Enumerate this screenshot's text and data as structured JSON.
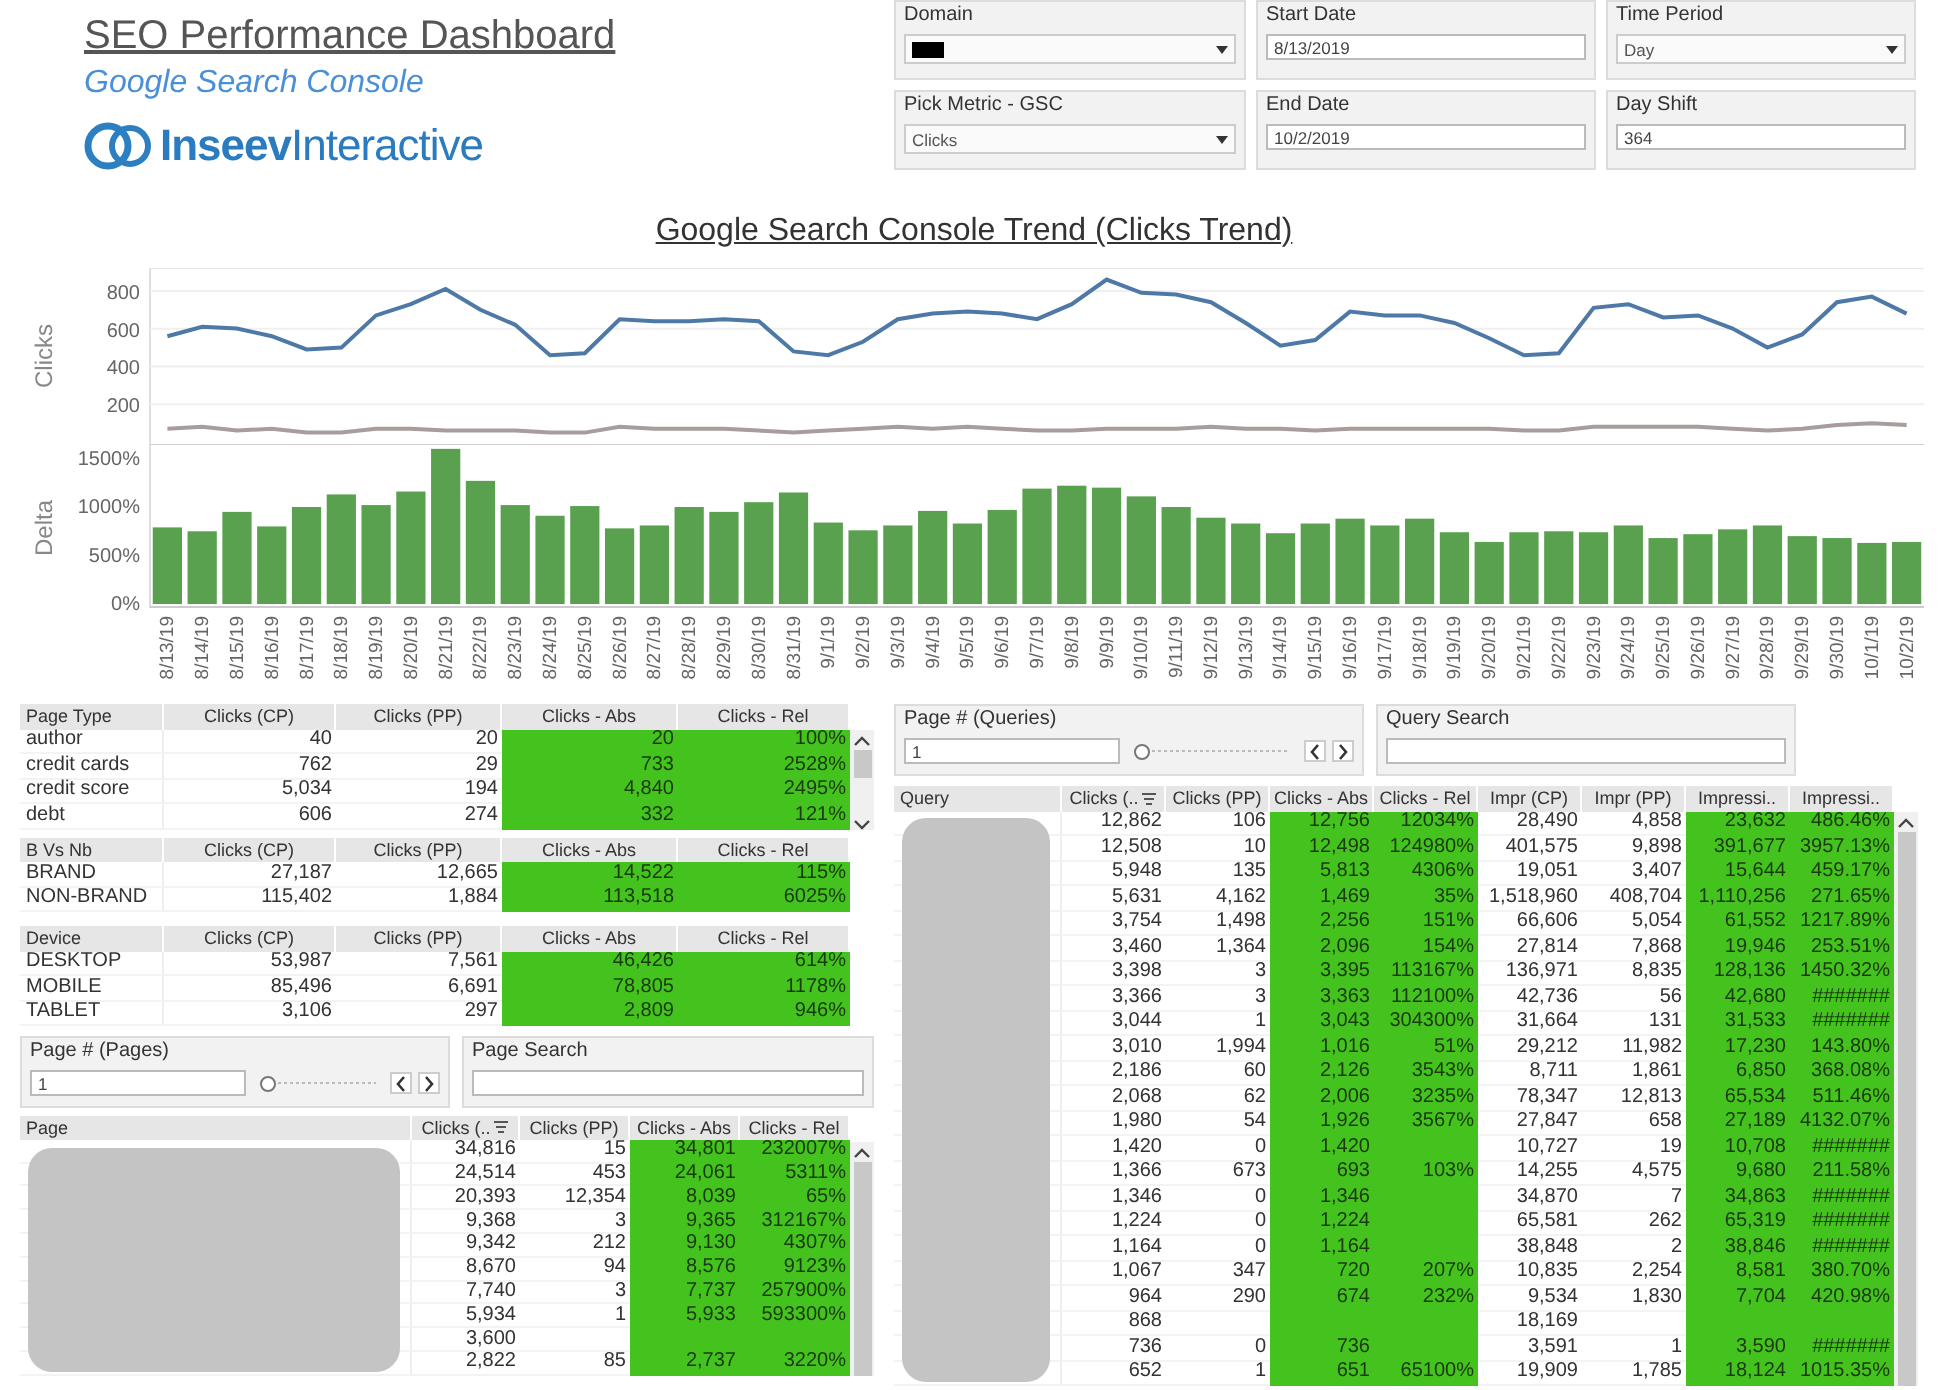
{
  "header": {
    "title": "SEO Performance Dashboard",
    "subtitle": "Google Search Console",
    "logo_text": "**Inseev**Interactive"
  },
  "filters": [
    {
      "label": "Domain",
      "kind": "dropdown",
      "redacted": true
    },
    {
      "label": "Start Date",
      "kind": "text",
      "value": "8/13/2019"
    },
    {
      "label": "Time Period",
      "kind": "dropdown",
      "value": "Day"
    },
    {
      "label": "Pick Metric - GSC",
      "kind": "dropdown",
      "value": "Clicks"
    },
    {
      "label": "End Date",
      "kind": "text",
      "value": "10/2/2019"
    },
    {
      "label": "Day Shift",
      "kind": "text",
      "value": "364"
    }
  ],
  "trend": {
    "title": "Google Search Console Trend (Clicks Trend)",
    "clicks_chart": {
      "chart_data": {
        "type": "line",
        "ylabel": "Clicks",
        "grid": true,
        "ylim": [
          0,
          900
        ],
        "yticks": [
          200,
          400,
          600,
          800
        ],
        "series": [
          {
            "color": "#4e79a7",
            "values": [
              560,
              610,
              600,
              560,
              490,
              500,
              670,
              730,
              810,
              700,
              620,
              460,
              470,
              650,
              640,
              640,
              650,
              640,
              480,
              460,
              530,
              650,
              680,
              690,
              680,
              650,
              730,
              860,
              790,
              780,
              740,
              630,
              510,
              540,
              690,
              670,
              670,
              630,
              550,
              460,
              470,
              710,
              730,
              660,
              670,
              600,
              500,
              570,
              740,
              770,
              680
            ]
          },
          {
            "color": "#a89c9c",
            "values": [
              70,
              80,
              60,
              70,
              50,
              50,
              70,
              70,
              60,
              60,
              60,
              50,
              50,
              80,
              70,
              70,
              70,
              60,
              50,
              60,
              70,
              80,
              70,
              80,
              70,
              60,
              60,
              70,
              70,
              70,
              80,
              70,
              70,
              60,
              70,
              70,
              70,
              70,
              70,
              60,
              60,
              80,
              80,
              80,
              80,
              70,
              60,
              70,
              90,
              100,
              90
            ]
          }
        ]
      }
    },
    "delta_chart": {
      "chart_data": {
        "type": "bar",
        "ylabel": "Delta",
        "ylim": [
          0,
          1650
        ],
        "yticks": [
          {
            "value": 0,
            "label": "0%"
          },
          {
            "value": 500,
            "label": "500%"
          },
          {
            "value": 1000,
            "label": "1000%"
          },
          {
            "value": 1500,
            "label": "1500%"
          }
        ],
        "categories": [
          "8/13/19",
          "8/14/19",
          "8/15/19",
          "8/16/19",
          "8/17/19",
          "8/18/19",
          "8/19/19",
          "8/20/19",
          "8/21/19",
          "8/22/19",
          "8/23/19",
          "8/24/19",
          "8/25/19",
          "8/26/19",
          "8/27/19",
          "8/28/19",
          "8/29/19",
          "8/30/19",
          "8/31/19",
          "9/1/19",
          "9/2/19",
          "9/3/19",
          "9/4/19",
          "9/5/19",
          "9/6/19",
          "9/7/19",
          "9/8/19",
          "9/9/19",
          "9/10/19",
          "9/11/19",
          "9/12/19",
          "9/13/19",
          "9/14/19",
          "9/15/19",
          "9/16/19",
          "9/17/19",
          "9/18/19",
          "9/19/19",
          "9/20/19",
          "9/21/19",
          "9/22/19",
          "9/23/19",
          "9/24/19",
          "9/25/19",
          "9/26/19",
          "9/27/19",
          "9/28/19",
          "9/29/19",
          "9/30/19",
          "10/1/19",
          "10/2/19"
        ],
        "values": [
          790,
          750,
          950,
          800,
          1000,
          1130,
          1020,
          1160,
          1600,
          1270,
          1020,
          910,
          1010,
          780,
          810,
          1000,
          950,
          1050,
          1150,
          840,
          760,
          810,
          960,
          830,
          970,
          1190,
          1220,
          1200,
          1110,
          1000,
          890,
          830,
          730,
          830,
          880,
          810,
          880,
          740,
          640,
          740,
          750,
          740,
          810,
          680,
          720,
          770,
          810,
          700,
          680,
          630,
          640
        ]
      }
    }
  },
  "page_type_table": {
    "scrollable": true,
    "columns": [
      {
        "label": "Page Type",
        "kind": "dim"
      },
      {
        "label": "Clicks (CP)",
        "kind": "value"
      },
      {
        "label": "Clicks (PP)",
        "kind": "value"
      },
      {
        "label": "Clicks - Abs",
        "kind": "delta"
      },
      {
        "label": "Clicks - Rel",
        "kind": "delta"
      }
    ],
    "rows": [
      [
        "author",
        "40",
        "20",
        "20",
        "100%"
      ],
      [
        "credit cards",
        "762",
        "29",
        "733",
        "2528%"
      ],
      [
        "credit score",
        "5,034",
        "194",
        "4,840",
        "2495%"
      ],
      [
        "debt",
        "606",
        "274",
        "332",
        "121%"
      ]
    ]
  },
  "brand_table": {
    "columns": [
      {
        "label": "B Vs Nb",
        "kind": "dim"
      },
      {
        "label": "Clicks (CP)",
        "kind": "value"
      },
      {
        "label": "Clicks (PP)",
        "kind": "value"
      },
      {
        "label": "Clicks - Abs",
        "kind": "delta"
      },
      {
        "label": "Clicks - Rel",
        "kind": "delta"
      }
    ],
    "rows": [
      [
        "BRAND",
        "27,187",
        "12,665",
        "14,522",
        "115%"
      ],
      [
        "NON-BRAND",
        "115,402",
        "1,884",
        "113,518",
        "6025%"
      ]
    ]
  },
  "device_table": {
    "columns": [
      {
        "label": "Device",
        "kind": "dim"
      },
      {
        "label": "Clicks (CP)",
        "kind": "value"
      },
      {
        "label": "Clicks (PP)",
        "kind": "value"
      },
      {
        "label": "Clicks - Abs",
        "kind": "delta"
      },
      {
        "label": "Clicks - Rel",
        "kind": "delta"
      }
    ],
    "rows": [
      [
        "DESKTOP",
        "53,987",
        "7,561",
        "46,426",
        "614%"
      ],
      [
        "MOBILE",
        "85,496",
        "6,691",
        "78,805",
        "1178%"
      ],
      [
        "TABLET",
        "3,106",
        "297",
        "2,809",
        "946%"
      ]
    ]
  },
  "page_filters": [
    {
      "label": "Page # (Pages)",
      "kind": "slider",
      "value": "1",
      "level": 0
    },
    {
      "label": "Page Search",
      "kind": "search"
    }
  ],
  "pages_table": {
    "scrollable": true,
    "names_redacted": true,
    "columns": [
      {
        "label": "Page",
        "kind": "dim"
      },
      {
        "label": "Clicks (..",
        "kind": "value",
        "sorted": true
      },
      {
        "label": "Clicks (PP)",
        "kind": "value"
      },
      {
        "label": "Clicks - Abs",
        "kind": "delta"
      },
      {
        "label": "Clicks - Rel",
        "kind": "delta"
      }
    ],
    "rows": [
      [
        null,
        "34,816",
        "15",
        "34,801",
        "232007%"
      ],
      [
        null,
        "24,514",
        "453",
        "24,061",
        "5311%"
      ],
      [
        null,
        "20,393",
        "12,354",
        "8,039",
        "65%"
      ],
      [
        null,
        "9,368",
        "3",
        "9,365",
        "312167%"
      ],
      [
        null,
        "9,342",
        "212",
        "9,130",
        "4307%"
      ],
      [
        null,
        "8,670",
        "94",
        "8,576",
        "9123%"
      ],
      [
        null,
        "7,740",
        "3",
        "7,737",
        "257900%"
      ],
      [
        null,
        "5,934",
        "1",
        "5,933",
        "593300%"
      ],
      [
        null,
        "3,600",
        null,
        null,
        null
      ],
      [
        null,
        "2,822",
        "85",
        "2,737",
        "3220%"
      ]
    ]
  },
  "query_filters": [
    {
      "label": "Page # (Queries)",
      "kind": "slider",
      "value": "1",
      "level": 0
    },
    {
      "label": "Query Search",
      "kind": "search"
    }
  ],
  "queries_table": {
    "scrollable": true,
    "names_redacted": true,
    "columns": [
      {
        "label": "Query",
        "kind": "dim"
      },
      {
        "label": "Clicks (..",
        "kind": "value",
        "sorted": true
      },
      {
        "label": "Clicks (PP)",
        "kind": "value"
      },
      {
        "label": "Clicks - Abs",
        "kind": "delta"
      },
      {
        "label": "Clicks - Rel",
        "kind": "delta"
      },
      {
        "label": "Impr (CP)",
        "kind": "value"
      },
      {
        "label": "Impr (PP)",
        "kind": "value"
      },
      {
        "label": "Impressi..",
        "kind": "delta"
      },
      {
        "label": "Impressi..",
        "kind": "delta"
      }
    ],
    "rows": [
      [
        null,
        "12,862",
        "106",
        "12,756",
        "12034%",
        "28,490",
        "4,858",
        "23,632",
        "486.46%"
      ],
      [
        null,
        "12,508",
        "10",
        "12,498",
        "124980%",
        "401,575",
        "9,898",
        "391,677",
        "3957.13%"
      ],
      [
        null,
        "5,948",
        "135",
        "5,813",
        "4306%",
        "19,051",
        "3,407",
        "15,644",
        "459.17%"
      ],
      [
        null,
        "5,631",
        "4,162",
        "1,469",
        "35%",
        "1,518,960",
        "408,704",
        "1,110,256",
        "271.65%"
      ],
      [
        null,
        "3,754",
        "1,498",
        "2,256",
        "151%",
        "66,606",
        "5,054",
        "61,552",
        "1217.89%"
      ],
      [
        null,
        "3,460",
        "1,364",
        "2,096",
        "154%",
        "27,814",
        "7,868",
        "19,946",
        "253.51%"
      ],
      [
        null,
        "3,398",
        "3",
        "3,395",
        "113167%",
        "136,971",
        "8,835",
        "128,136",
        "1450.32%"
      ],
      [
        null,
        "3,366",
        "3",
        "3,363",
        "112100%",
        "42,736",
        "56",
        "42,680",
        "#######"
      ],
      [
        null,
        "3,044",
        "1",
        "3,043",
        "304300%",
        "31,664",
        "131",
        "31,533",
        "#######"
      ],
      [
        null,
        "3,010",
        "1,994",
        "1,016",
        "51%",
        "29,212",
        "11,982",
        "17,230",
        "143.80%"
      ],
      [
        null,
        "2,186",
        "60",
        "2,126",
        "3543%",
        "8,711",
        "1,861",
        "6,850",
        "368.08%"
      ],
      [
        null,
        "2,068",
        "62",
        "2,006",
        "3235%",
        "78,347",
        "12,813",
        "65,534",
        "511.46%"
      ],
      [
        null,
        "1,980",
        "54",
        "1,926",
        "3567%",
        "27,847",
        "658",
        "27,189",
        "4132.07%"
      ],
      [
        null,
        "1,420",
        "0",
        "1,420",
        null,
        "10,727",
        "19",
        "10,708",
        "#######"
      ],
      [
        null,
        "1,366",
        "673",
        "693",
        "103%",
        "14,255",
        "4,575",
        "9,680",
        "211.58%"
      ],
      [
        null,
        "1,346",
        "0",
        "1,346",
        null,
        "34,870",
        "7",
        "34,863",
        "#######"
      ],
      [
        null,
        "1,224",
        "0",
        "1,224",
        null,
        "65,581",
        "262",
        "65,319",
        "#######"
      ],
      [
        null,
        "1,164",
        "0",
        "1,164",
        null,
        "38,848",
        "2",
        "38,846",
        "#######"
      ],
      [
        null,
        "1,067",
        "347",
        "720",
        "207%",
        "10,835",
        "2,254",
        "8,581",
        "380.70%"
      ],
      [
        null,
        "964",
        "290",
        "674",
        "232%",
        "9,534",
        "1,830",
        "7,704",
        "420.98%"
      ],
      [
        null,
        "868",
        null,
        null,
        null,
        "18,169",
        null,
        null,
        null
      ],
      [
        null,
        "736",
        "0",
        "736",
        null,
        "3,591",
        "1",
        "3,590",
        "#######"
      ],
      [
        null,
        "652",
        "1",
        "651",
        "65100%",
        "19,909",
        "1,785",
        "18,124",
        "1015.35%"
      ]
    ]
  }
}
